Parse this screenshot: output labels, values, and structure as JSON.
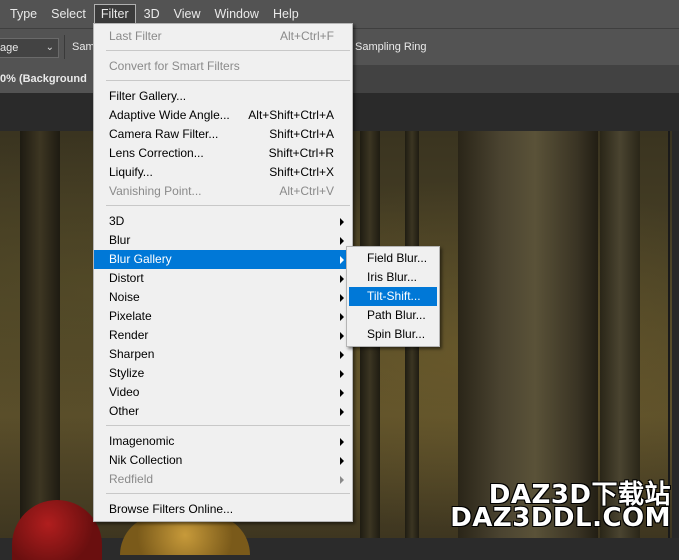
{
  "menubar": {
    "items": [
      "Type",
      "Select",
      "Filter",
      "3D",
      "View",
      "Window",
      "Help"
    ],
    "open_index": 2
  },
  "options_bar": {
    "select_value": "age",
    "sample_label": "Sam",
    "sampling_ring_label": "Sampling Ring"
  },
  "doc_tab": {
    "title": "0% (Background"
  },
  "filter_menu": {
    "items": [
      {
        "label": "Last Filter",
        "shortcut": "Alt+Ctrl+F",
        "disabled": true
      },
      {
        "label": "Convert for Smart Filters",
        "disabled": true
      },
      {
        "label": "Filter Gallery..."
      },
      {
        "label": "Adaptive Wide Angle...",
        "shortcut": "Alt+Shift+Ctrl+A"
      },
      {
        "label": "Camera Raw Filter...",
        "shortcut": "Shift+Ctrl+A"
      },
      {
        "label": "Lens Correction...",
        "shortcut": "Shift+Ctrl+R"
      },
      {
        "label": "Liquify...",
        "shortcut": "Shift+Ctrl+X"
      },
      {
        "label": "Vanishing Point...",
        "shortcut": "Alt+Ctrl+V",
        "disabled": true
      },
      {
        "label": "3D",
        "submenu": true
      },
      {
        "label": "Blur",
        "submenu": true
      },
      {
        "label": "Blur Gallery",
        "submenu": true,
        "highlighted": true
      },
      {
        "label": "Distort",
        "submenu": true
      },
      {
        "label": "Noise",
        "submenu": true
      },
      {
        "label": "Pixelate",
        "submenu": true
      },
      {
        "label": "Render",
        "submenu": true
      },
      {
        "label": "Sharpen",
        "submenu": true
      },
      {
        "label": "Stylize",
        "submenu": true
      },
      {
        "label": "Video",
        "submenu": true
      },
      {
        "label": "Other",
        "submenu": true
      },
      {
        "label": "Imagenomic",
        "submenu": true
      },
      {
        "label": "Nik Collection",
        "submenu": true
      },
      {
        "label": "Redfield",
        "submenu": true,
        "disabled": true
      },
      {
        "label": "Browse Filters Online..."
      }
    ]
  },
  "blur_gallery_submenu": {
    "items": [
      "Field Blur...",
      "Iris Blur...",
      "Tilt-Shift...",
      "Path Blur...",
      "Spin Blur..."
    ],
    "highlighted_index": 2
  },
  "watermark": {
    "line1": "DAZ3D下载站",
    "line2": "DAZ3DDL.COM"
  }
}
